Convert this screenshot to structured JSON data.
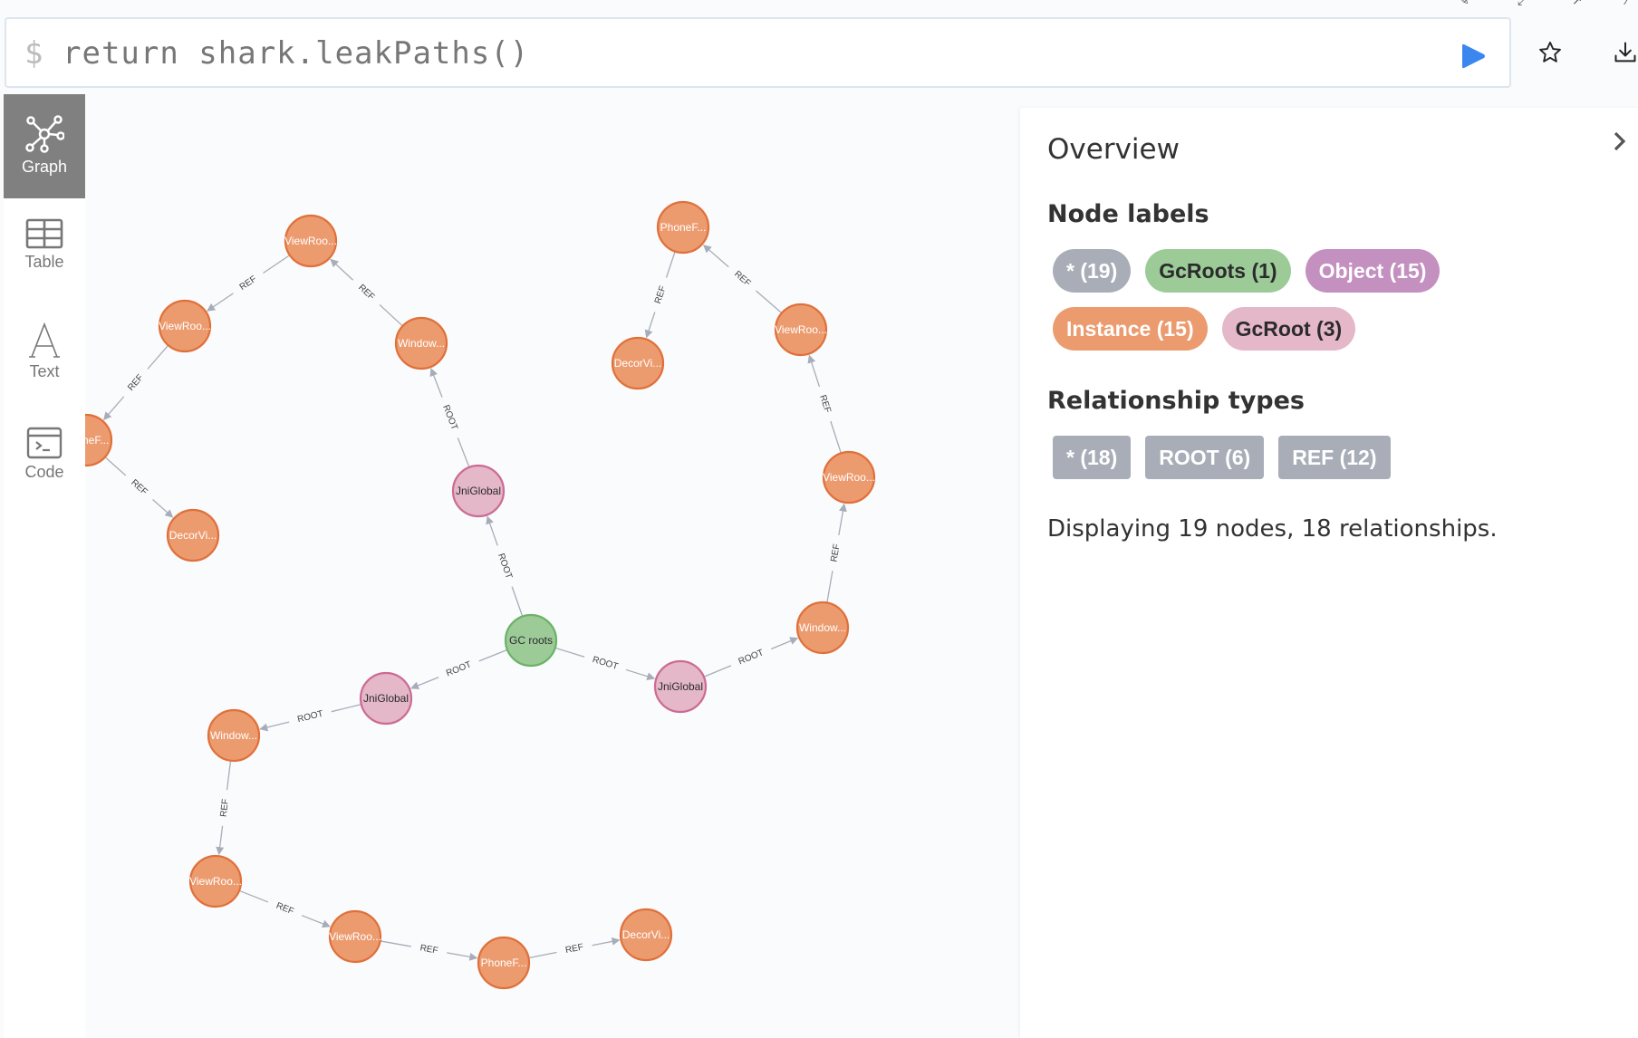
{
  "editor": {
    "prompt": "$",
    "query": "return shark.leakPaths()",
    "run_icon": "play-icon",
    "favorite_icon": "star-icon",
    "download_icon": "download-icon"
  },
  "sidebar": {
    "items": [
      {
        "label": "Graph",
        "icon": "graph-icon",
        "active": true
      },
      {
        "label": "Table",
        "icon": "table-icon",
        "active": false
      },
      {
        "label": "Text",
        "icon": "text-icon",
        "active": false
      },
      {
        "label": "Code",
        "icon": "code-icon",
        "active": false
      }
    ]
  },
  "colors": {
    "instance": "#ec9b6f",
    "instance_border": "#e0703a",
    "gcroots": "#9ccb98",
    "gcroots_border": "#6bb366",
    "gcroot": "#e4b7c9",
    "gcroot_border": "#cd6a93",
    "object": "#c390c0",
    "all": "#a8adb7",
    "edge": "#a7adb8",
    "run": "#3b86ef"
  },
  "graph": {
    "nodes": [
      {
        "id": "n1",
        "label": "ViewRoo...",
        "type": "instance"
      },
      {
        "id": "n2",
        "label": "ViewRoo...",
        "type": "instance"
      },
      {
        "id": "n3",
        "label": "PhoneF...",
        "type": "instance"
      },
      {
        "id": "n4",
        "label": "DecorVi...",
        "type": "instance"
      },
      {
        "id": "n5",
        "label": "Window...",
        "type": "instance"
      },
      {
        "id": "n6",
        "label": "JniGlobal",
        "type": "gcroot"
      },
      {
        "id": "n7",
        "label": "GC roots",
        "type": "gcroots"
      },
      {
        "id": "n8",
        "label": "JniGlobal",
        "type": "gcroot"
      },
      {
        "id": "n9",
        "label": "Window...",
        "type": "instance"
      },
      {
        "id": "n10",
        "label": "ViewRoo...",
        "type": "instance"
      },
      {
        "id": "n11",
        "label": "ViewRoo...",
        "type": "instance"
      },
      {
        "id": "n12",
        "label": "PhoneF...",
        "type": "instance"
      },
      {
        "id": "n13",
        "label": "DecorVi...",
        "type": "instance"
      },
      {
        "id": "n14",
        "label": "JniGlobal",
        "type": "gcroot"
      },
      {
        "id": "n15",
        "label": "Window...",
        "type": "instance"
      },
      {
        "id": "n16",
        "label": "ViewRoo...",
        "type": "instance"
      },
      {
        "id": "n17",
        "label": "ViewRoo...",
        "type": "instance"
      },
      {
        "id": "n18",
        "label": "PhoneF...",
        "type": "instance"
      },
      {
        "id": "n19",
        "label": "DecorVi...",
        "type": "instance"
      }
    ],
    "edges": [
      {
        "from": "n7",
        "to": "n6",
        "type": "ROOT"
      },
      {
        "from": "n6",
        "to": "n5",
        "type": "ROOT"
      },
      {
        "from": "n5",
        "to": "n1",
        "type": "REF"
      },
      {
        "from": "n1",
        "to": "n2",
        "type": "REF"
      },
      {
        "from": "n2",
        "to": "n3",
        "type": "REF"
      },
      {
        "from": "n3",
        "to": "n4",
        "type": "REF"
      },
      {
        "from": "n7",
        "to": "n8",
        "type": "ROOT"
      },
      {
        "from": "n8",
        "to": "n9",
        "type": "ROOT"
      },
      {
        "from": "n9",
        "to": "n10",
        "type": "REF"
      },
      {
        "from": "n10",
        "to": "n11",
        "type": "REF"
      },
      {
        "from": "n11",
        "to": "n12",
        "type": "REF"
      },
      {
        "from": "n12",
        "to": "n13",
        "type": "REF"
      },
      {
        "from": "n7",
        "to": "n14",
        "type": "ROOT"
      },
      {
        "from": "n14",
        "to": "n15",
        "type": "ROOT"
      },
      {
        "from": "n15",
        "to": "n16",
        "type": "REF"
      },
      {
        "from": "n16",
        "to": "n17",
        "type": "REF"
      },
      {
        "from": "n17",
        "to": "n18",
        "type": "REF"
      },
      {
        "from": "n18",
        "to": "n19",
        "type": "REF"
      }
    ]
  },
  "overview": {
    "title": "Overview",
    "collapse_icon": "chevron-right-icon",
    "node_labels_heading": "Node labels",
    "node_labels": [
      {
        "text": "* (19)",
        "kind": "all"
      },
      {
        "text": "GcRoots (1)",
        "kind": "gcroots"
      },
      {
        "text": "Object (15)",
        "kind": "object"
      },
      {
        "text": "Instance (15)",
        "kind": "instance"
      },
      {
        "text": "GcRoot (3)",
        "kind": "gcroot"
      }
    ],
    "relationship_types_heading": "Relationship types",
    "relationship_types": [
      {
        "text": "* (18)"
      },
      {
        "text": "ROOT (6)"
      },
      {
        "text": "REF (12)"
      }
    ],
    "status": "Displaying 19 nodes, 18 relationships."
  }
}
